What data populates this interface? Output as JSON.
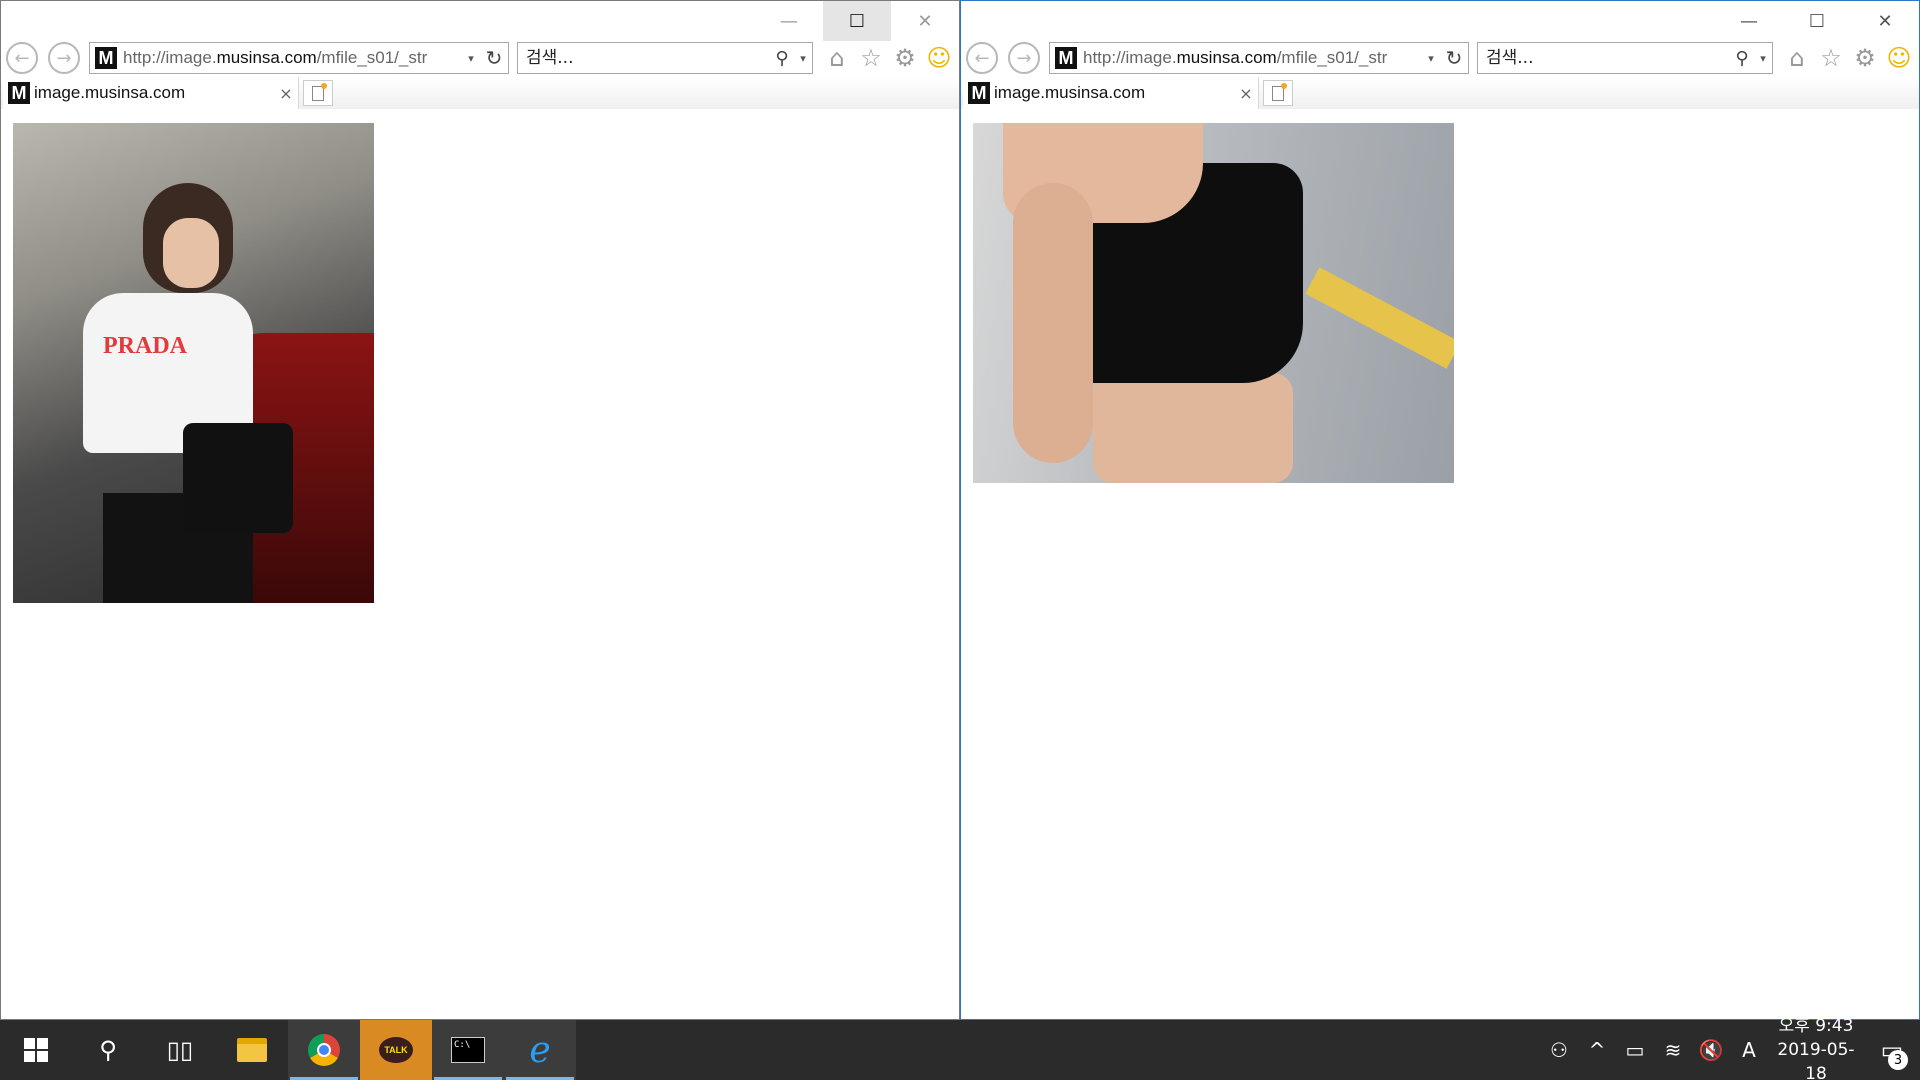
{
  "windows": [
    {
      "id": "left",
      "url_prefix": "http://image.",
      "url_domain": "musinsa.com",
      "url_suffix": "/mfile_s01/_str",
      "search_placeholder": "검색...",
      "favicon_letter": "M",
      "tab_title": "image.musinsa.com",
      "image_description": "street-style photo woman PRADA shirt"
    },
    {
      "id": "right",
      "url_prefix": "http://image.",
      "url_domain": "musinsa.com",
      "url_suffix": "/mfile_s01/_str",
      "search_placeholder": "검색...",
      "favicon_letter": "M",
      "tab_title": "image.musinsa.com",
      "image_description": "close-up black leather mini skirt"
    }
  ],
  "photo_text": {
    "shirt_logo": "PRADA"
  },
  "icons": {
    "back": "←",
    "forward": "→",
    "dropdown": "▾",
    "refresh": "↻",
    "search": "⚲",
    "home": "⌂",
    "favorites": "☆",
    "settings": "⚙",
    "smile": "☺",
    "tab_close": "×",
    "minimize": "—",
    "maximize": "☐",
    "close": "✕"
  },
  "taskbar": {
    "kakao_label": "TALK",
    "tray": {
      "ime": "A"
    },
    "clock": {
      "time": "오후 9:43",
      "date": "2019-05-18"
    },
    "notification_count": "3"
  },
  "colors": {
    "active_border": "#2b79c6",
    "taskbar_bg": "#2b2b2b",
    "kakao": "#d98a22",
    "taskbar_active_indicator": "#76b9ed"
  }
}
